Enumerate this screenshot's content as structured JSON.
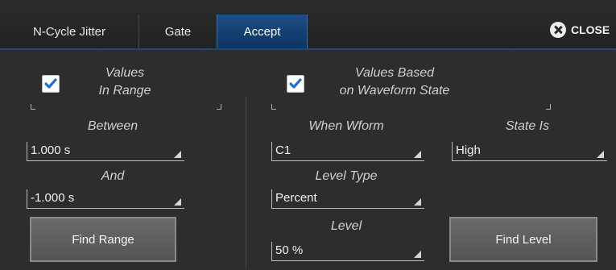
{
  "tabs": [
    {
      "label": "N-Cycle Jitter",
      "active": false
    },
    {
      "label": "Gate",
      "active": false
    },
    {
      "label": "Accept",
      "active": true
    }
  ],
  "close_label": "CLOSE",
  "left": {
    "checkbox_label_line1": "Values",
    "checkbox_label_line2": "In Range",
    "checked": true,
    "between_label": "Between",
    "between_value": "1.000 s",
    "and_label": "And",
    "and_value": "-1.000 s",
    "find_range_label": "Find Range"
  },
  "right": {
    "checkbox_label_line1": "Values Based",
    "checkbox_label_line2": "on Waveform State",
    "checked": true,
    "when_wform_label": "When Wform",
    "when_wform_value": "C1",
    "state_is_label": "State Is",
    "state_is_value": "High",
    "level_type_label": "Level Type",
    "level_type_value": "Percent",
    "level_label": "Level",
    "level_value": "50 %",
    "find_level_label": "Find Level"
  },
  "colors": {
    "accent": "#1d4f86",
    "background": "#2d2d2d",
    "checkbox_check": "#1f6fd1"
  }
}
